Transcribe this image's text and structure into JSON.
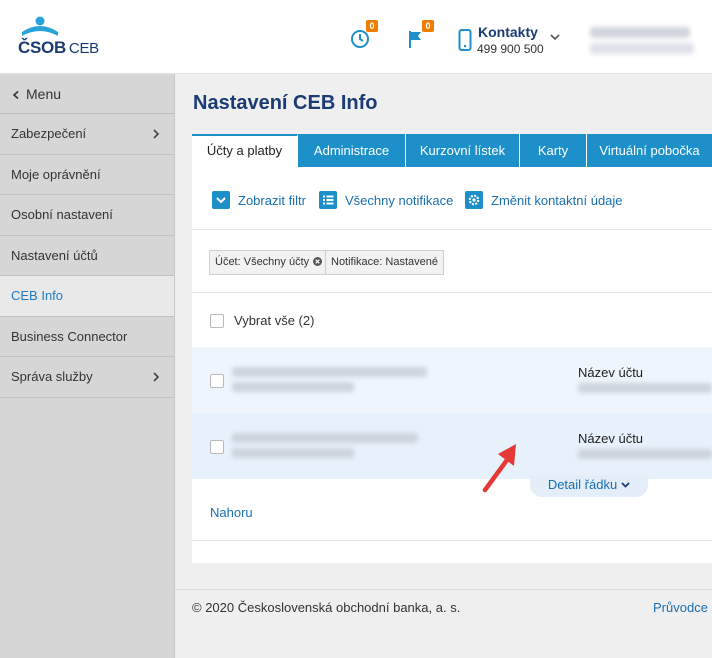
{
  "header": {
    "logo_brand": "ČSOB",
    "logo_product": "CEB",
    "history_badge": "0",
    "flag_badge": "0",
    "contacts_title": "Kontakty",
    "contacts_phone": "499 900 500"
  },
  "sidebar": {
    "menu_label": "Menu",
    "items": [
      {
        "label": "Zabezpečení",
        "has_arrow": true
      },
      {
        "label": "Moje oprávnění",
        "has_arrow": false
      },
      {
        "label": "Osobní nastavení",
        "has_arrow": false
      },
      {
        "label": "Nastavení účtů",
        "has_arrow": false
      },
      {
        "label": "CEB Info",
        "has_arrow": false,
        "active": true
      },
      {
        "label": "Business Connector",
        "has_arrow": false
      },
      {
        "label": "Správa služby",
        "has_arrow": true
      }
    ]
  },
  "main": {
    "title": "Nastavení CEB Info",
    "tabs": [
      {
        "label": "Účty a platby",
        "active": true
      },
      {
        "label": "Administrace"
      },
      {
        "label": "Kurzovní lístek"
      },
      {
        "label": "Karty"
      },
      {
        "label": "Virtuální pobočka"
      }
    ],
    "toolbar": {
      "show_filter": "Zobrazit filtr",
      "all_notifications": "Všechny notifikace",
      "change_contact": "Změnit kontaktní údaje"
    },
    "filters": {
      "account_chip": "Účet: Všechny účty",
      "notification_chip": "Notifikace: Nastavené"
    },
    "select_all": "Vybrat vše (2)",
    "rows": [
      {
        "name_label": "Název účtu"
      },
      {
        "name_label": "Název účtu"
      }
    ],
    "row_detail": "Detail řádku",
    "back_to_top": "Nahoru"
  },
  "footer": {
    "copyright": "© 2020 Československá obchodní banka, a. s.",
    "guide_link": "Průvodce b"
  },
  "colors": {
    "brand_blue": "#1a3b73",
    "tab_blue": "#1e90c9",
    "link_blue": "#1a6fb3",
    "badge_orange": "#f07d00",
    "annotation_red": "#e53935"
  }
}
